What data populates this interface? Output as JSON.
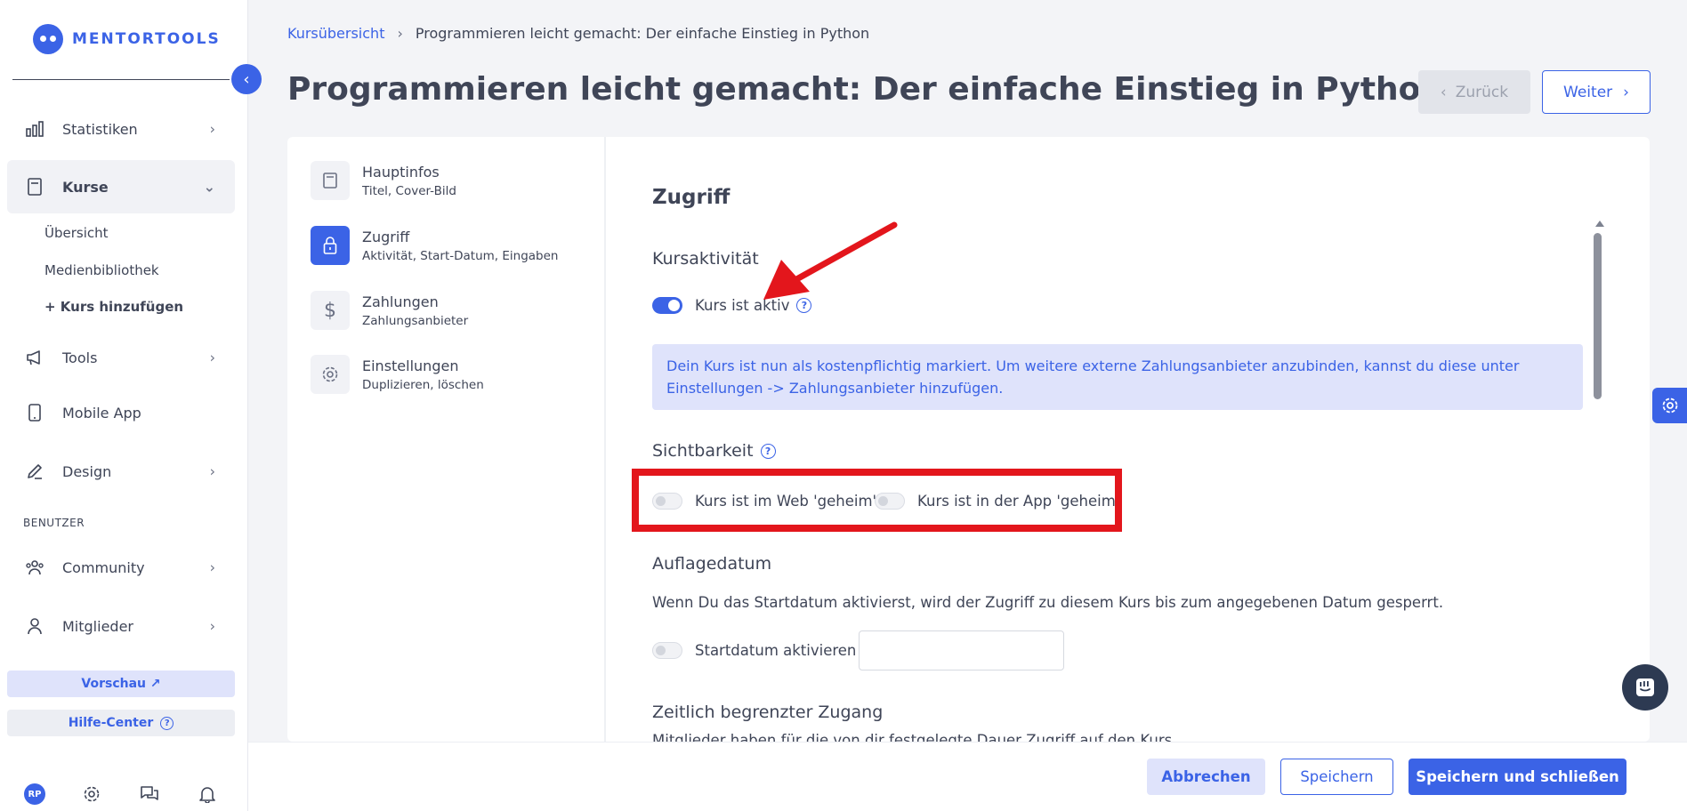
{
  "brand": {
    "name": "MENTORTOOLS"
  },
  "sidebar": {
    "items": [
      {
        "label": "Statistiken"
      },
      {
        "label": "Kurse"
      },
      {
        "label": "Tools"
      },
      {
        "label": "Mobile App"
      },
      {
        "label": "Design"
      },
      {
        "label": "Community"
      },
      {
        "label": "Mitglieder"
      }
    ],
    "kurse_sub": [
      {
        "label": "Übersicht"
      },
      {
        "label": "Medienbibliothek"
      },
      {
        "label": "+ Kurs hinzufügen"
      }
    ],
    "section_label": "BENUTZER",
    "preview_label": "Vorschau ↗",
    "help_label": "Hilfe-Center",
    "avatar_initials": "RP"
  },
  "breadcrumb": {
    "root": "Kursübersicht",
    "current": "Programmieren leicht gemacht: Der einfache Einstieg in Python"
  },
  "page": {
    "title": "Programmieren leicht gemacht: Der einfache Einstieg in Python",
    "back_label": "Zurück",
    "next_label": "Weiter"
  },
  "steps": [
    {
      "title": "Hauptinfos",
      "subtitle": "Titel, Cover-Bild"
    },
    {
      "title": "Zugriff",
      "subtitle": "Aktivität, Start-Datum, Eingaben"
    },
    {
      "title": "Zahlungen",
      "subtitle": "Zahlungsanbieter"
    },
    {
      "title": "Einstellungen",
      "subtitle": "Duplizieren, löschen"
    }
  ],
  "content": {
    "section_title": "Zugriff",
    "course_activity": {
      "heading": "Kursaktivität",
      "toggle_label": "Kurs ist aktiv",
      "toggle_on": true
    },
    "info_text": "Dein Kurs ist nun als kostenpflichtig markiert. Um weitere externe Zahlungsanbieter anzubinden, kannst du diese unter Einstellungen -> Zahlungsanbieter hinzufügen.",
    "visibility": {
      "heading": "Sichtbarkeit",
      "web_label": "Kurs ist im Web 'geheim'",
      "app_label": "Kurs ist in der App 'geheim'"
    },
    "release_date": {
      "heading": "Auflagedatum",
      "description": "Wenn Du das Startdatum aktivierst, wird der Zugriff zu diesem Kurs bis zum angegebenen Datum gesperrt.",
      "toggle_label": "Startdatum aktivieren",
      "input_value": ""
    },
    "limited_access": {
      "heading": "Zeitlich begrenzter Zugang",
      "description": "Mitglieder haben für die von dir festgelegte Dauer Zugriff auf den Kurs."
    }
  },
  "footer": {
    "cancel_label": "Abbrechen",
    "save_label": "Speichern",
    "save_close_label": "Speichern und schließen"
  },
  "colors": {
    "accent": "#3b63e6",
    "annotation": "#e3161c"
  }
}
